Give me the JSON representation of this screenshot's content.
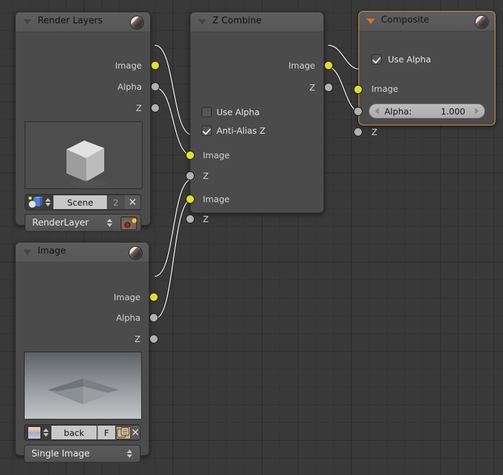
{
  "editor": {
    "background_color": "#393939",
    "grid_color": "#2f2f2f"
  },
  "nodes": [
    {
      "id": "render-layers",
      "title": "Render Layers",
      "selected": false,
      "collapse_icon": "triangle-down-icon",
      "preview_icon": "sphere-preview-icon",
      "outputs": [
        {
          "label": "Image",
          "type": "image",
          "color": "#dfdf29"
        },
        {
          "label": "Alpha",
          "type": "value",
          "color": "#b0b0b0"
        },
        {
          "label": "Z",
          "type": "value",
          "color": "#b0b0b0"
        }
      ],
      "preview": {
        "kind": "render-cube-preview"
      },
      "scene_row": {
        "icon": "scene-icon",
        "name": "Scene",
        "users": "2",
        "clear_icon": "x-icon"
      },
      "layer_row": {
        "name": "RenderLayer",
        "render_icon": "camera-render-icon"
      }
    },
    {
      "id": "z-combine",
      "title": "Z Combine",
      "selected": false,
      "collapse_icon": "triangle-down-icon",
      "outputs": [
        {
          "label": "Image",
          "type": "image",
          "color": "#dfdf29"
        },
        {
          "label": "Z",
          "type": "value",
          "color": "#b0b0b0"
        }
      ],
      "checkboxes": [
        {
          "label": "Use Alpha",
          "checked": false
        },
        {
          "label": "Anti-Alias Z",
          "checked": true
        }
      ],
      "inputs": [
        {
          "label": "Image",
          "type": "image",
          "color": "#dfdf29"
        },
        {
          "label": "Z",
          "type": "value",
          "color": "#b0b0b0"
        },
        {
          "label": "Image",
          "type": "image",
          "color": "#dfdf29"
        },
        {
          "label": "Z",
          "type": "value",
          "color": "#b0b0b0"
        }
      ]
    },
    {
      "id": "composite",
      "title": "Composite",
      "selected": true,
      "border_color": "#d4933f",
      "collapse_icon": "triangle-down-icon",
      "collapse_icon_color": "#e0701a",
      "preview_icon": "sphere-preview-icon",
      "checkboxes": [
        {
          "label": "Use Alpha",
          "checked": true
        }
      ],
      "inputs": [
        {
          "label": "Image",
          "type": "image",
          "color": "#dfdf29"
        },
        {
          "label": "Alpha",
          "type": "value",
          "color": "#b0b0b0"
        },
        {
          "label": "Z",
          "type": "value",
          "color": "#b0b0b0"
        }
      ],
      "alpha_slider": {
        "label": "Alpha:",
        "value": "1.000"
      }
    },
    {
      "id": "image",
      "title": "Image",
      "selected": false,
      "collapse_icon": "triangle-down-icon",
      "preview_icon": "sphere-preview-icon",
      "outputs": [
        {
          "label": "Image",
          "type": "image",
          "color": "#dfdf29"
        },
        {
          "label": "Alpha",
          "type": "value",
          "color": "#b0b0b0"
        },
        {
          "label": "Z",
          "type": "value",
          "color": "#b0b0b0"
        }
      ],
      "preview": {
        "kind": "depth-plane-preview"
      },
      "datablock_row": {
        "icon": "image-datablock-icon",
        "name": "back",
        "fake_user": "F",
        "copy_icon": "new-copy-icon",
        "clear_icon": "x-icon"
      },
      "source_row": {
        "value": "Single Image"
      }
    }
  ],
  "links": [
    {
      "from": "render-layers.Image",
      "to": "z-combine.Image1",
      "color": "#d8d8d8"
    },
    {
      "from": "render-layers.Z",
      "to": "z-combine.Z1",
      "color": "#d8d8d8"
    },
    {
      "from": "image.Image",
      "to": "z-combine.Image2",
      "color": "#d8d8d8"
    },
    {
      "from": "image.Z",
      "to": "z-combine.Z2",
      "color": "#d8d8d8"
    },
    {
      "from": "z-combine.Image",
      "to": "composite.Image",
      "color": "#d8d8d8"
    },
    {
      "from": "z-combine.Z",
      "to": "composite.Z",
      "color": "#d8d8d8"
    }
  ]
}
